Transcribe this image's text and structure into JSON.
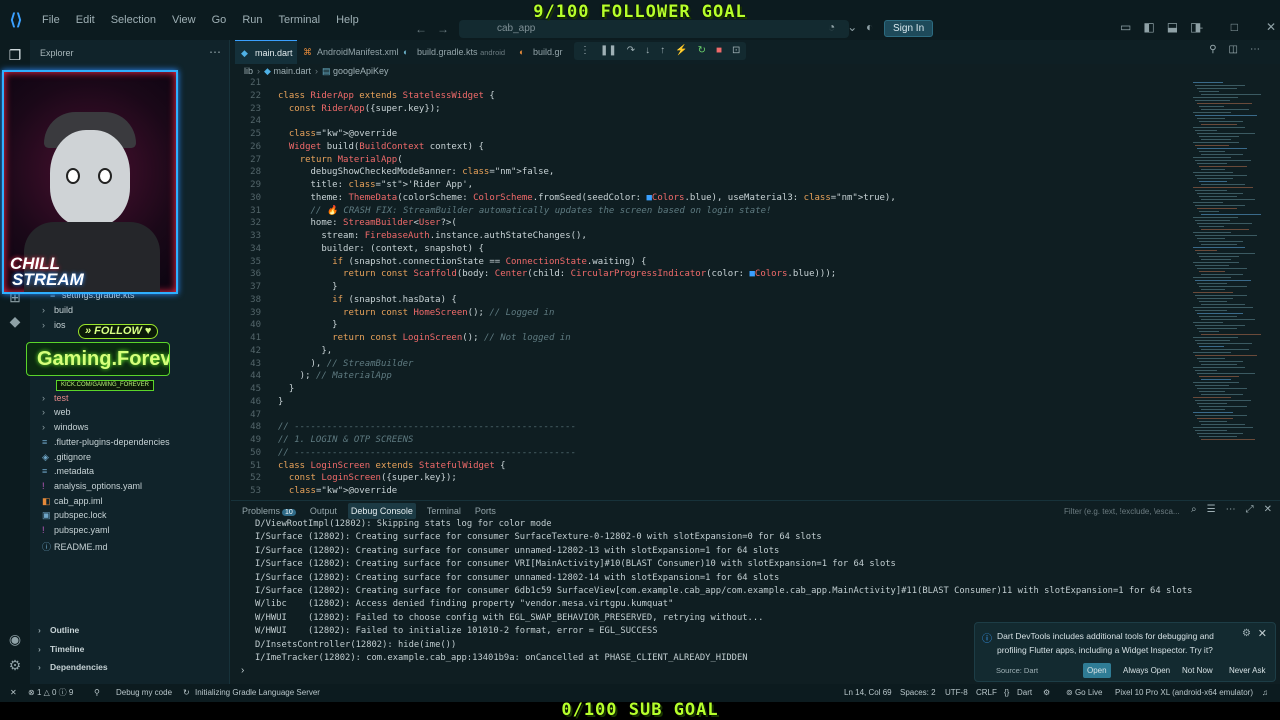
{
  "overlay": {
    "follower_goal": "9/100 FOLLOWER GOAL",
    "sub_goal": "0/100 SUB GOAL",
    "webcam_text_1": "CHILL",
    "webcam_text_2": "STREAM",
    "follow_label": "» FOLLOW ♥",
    "follow_name": "Gaming.Forev",
    "follow_url": "KICK.COM/GAMING_FOREVER"
  },
  "menu": [
    "File",
    "Edit",
    "Selection",
    "View",
    "Go",
    "Run",
    "Terminal",
    "Help"
  ],
  "command_center": {
    "value": "cab_app"
  },
  "signin_label": "Sign In",
  "sidebar": {
    "title": "Explorer",
    "tree": [
      {
        "label": "settings.gradle.kts",
        "type": "file"
      },
      {
        "label": "build",
        "type": "folder"
      },
      {
        "label": "ios",
        "type": "folder"
      },
      {
        "label": "test",
        "type": "folder"
      },
      {
        "label": "web",
        "type": "folder"
      },
      {
        "label": "windows",
        "type": "folder"
      },
      {
        "label": ".flutter-plugins-dependencies",
        "type": "file"
      },
      {
        "label": ".gitignore",
        "type": "file"
      },
      {
        "label": ".metadata",
        "type": "file"
      },
      {
        "label": "analysis_options.yaml",
        "type": "file"
      },
      {
        "label": "cab_app.iml",
        "type": "file"
      },
      {
        "label": "pubspec.lock",
        "type": "file"
      },
      {
        "label": "pubspec.yaml",
        "type": "file"
      },
      {
        "label": "README.md",
        "type": "file"
      }
    ],
    "sections": [
      "Outline",
      "Timeline",
      "Dependencies"
    ]
  },
  "editor": {
    "tabs": [
      {
        "label": "main.dart",
        "sub": ""
      },
      {
        "label": "AndroidManifest.xml",
        "sub": ""
      },
      {
        "label": "build.gradle.kts",
        "sub": "android"
      },
      {
        "label": "build.gr",
        "sub": ""
      }
    ],
    "breadcrumb": [
      "lib",
      "main.dart",
      "googleApiKey"
    ],
    "line_numbers": [
      "21",
      "22",
      "23",
      "24",
      "25",
      "26",
      "27",
      "28",
      "29",
      "30",
      "31",
      "32",
      "33",
      "34",
      "35",
      "36",
      "37",
      "38",
      "39",
      "40",
      "41",
      "42",
      "43",
      "44",
      "45",
      "46",
      "47",
      "48",
      "49",
      "50",
      "51",
      "52",
      "53"
    ],
    "lines": [
      "",
      "class RiderApp extends StatelessWidget {",
      "  const RiderApp({super.key});",
      "",
      "  @override",
      "  Widget build(BuildContext context) {",
      "    return MaterialApp(",
      "      debugShowCheckedModeBanner: false,",
      "      title: 'Rider App',",
      "      theme: ThemeData(colorScheme: ColorScheme.fromSeed(seedColor: ■Colors.blue), useMaterial3: true),",
      "      // 🔥 CRASH FIX: StreamBuilder automatically updates the screen based on login state!",
      "      home: StreamBuilder<User?>(",
      "        stream: FirebaseAuth.instance.authStateChanges(),",
      "        builder: (context, snapshot) {",
      "          if (snapshot.connectionState == ConnectionState.waiting) {",
      "            return const Scaffold(body: Center(child: CircularProgressIndicator(color: ■Colors.blue)));",
      "          }",
      "          if (snapshot.hasData) {",
      "            return const HomeScreen(); // Logged in",
      "          }",
      "          return const LoginScreen(); // Not logged in",
      "        },",
      "      ), // StreamBuilder",
      "    ); // MaterialApp",
      "  }",
      "}",
      "",
      "// ----------------------------------------------------",
      "// 1. LOGIN & OTP SCREENS",
      "// ----------------------------------------------------",
      "class LoginScreen extends StatefulWidget {",
      "  const LoginScreen({super.key});",
      "  @override"
    ]
  },
  "panel": {
    "tabs": [
      {
        "label": "Problems",
        "badge": "10"
      },
      {
        "label": "Output",
        "badge": ""
      },
      {
        "label": "Debug Console",
        "badge": ""
      },
      {
        "label": "Terminal",
        "badge": ""
      },
      {
        "label": "Ports",
        "badge": ""
      }
    ],
    "filter_placeholder": "Filter (e.g. text, !exclude, \\esca...",
    "logs": [
      "D/ViewRootImpl(12802): Skipping stats log for color mode",
      "I/Surface (12802): Creating surface for consumer SurfaceTexture-0-12802-0 with slotExpansion=0 for 64 slots",
      "I/Surface (12802): Creating surface for consumer unnamed-12802-13 with slotExpansion=1 for 64 slots",
      "I/Surface (12802): Creating surface for consumer VRI[MainActivity]#10(BLAST Consumer)10 with slotExpansion=1 for 64 slots",
      "I/Surface (12802): Creating surface for consumer unnamed-12802-14 with slotExpansion=1 for 64 slots",
      "I/Surface (12802): Creating surface for consumer 6db1c59 SurfaceView[com.example.cab_app/com.example.cab_app.MainActivity]#11(BLAST Consumer)11 with slotExpansion=1 for 64 slots",
      "W/libc    (12802): Access denied finding property \"vendor.mesa.virtgpu.kumquat\"",
      "W/HWUI    (12802): Failed to choose config with EGL_SWAP_BEHAVIOR_PRESERVED, retrying without...",
      "W/HWUI    (12802): Failed to initialize 101010-2 format, error = EGL_SUCCESS",
      "D/InsetsController(12802): hide(ime())",
      "I/ImeTracker(12802): com.example.cab_app:13401b9a: onCancelled at PHASE_CLIENT_ALREADY_HIDDEN"
    ]
  },
  "notification": {
    "message": "Dart DevTools includes additional tools for debugging and profiling Flutter apps, including a Widget Inspector. Try it?",
    "source": "Source: Dart",
    "buttons": [
      "Open",
      "Always Open",
      "Not Now",
      "Never Ask"
    ]
  },
  "statusbar": {
    "errors": "1",
    "warnings": "0",
    "info": "9",
    "debug": "Debug my code",
    "task": "Initializing Gradle Language Server",
    "position": "Ln 14, Col 69",
    "spaces": "Spaces: 2",
    "encoding": "UTF-8",
    "eol": "CRLF",
    "language": "Dart",
    "golive": "Go Live",
    "device": "Pixel 10 Pro XL (android-x64 emulator)"
  }
}
